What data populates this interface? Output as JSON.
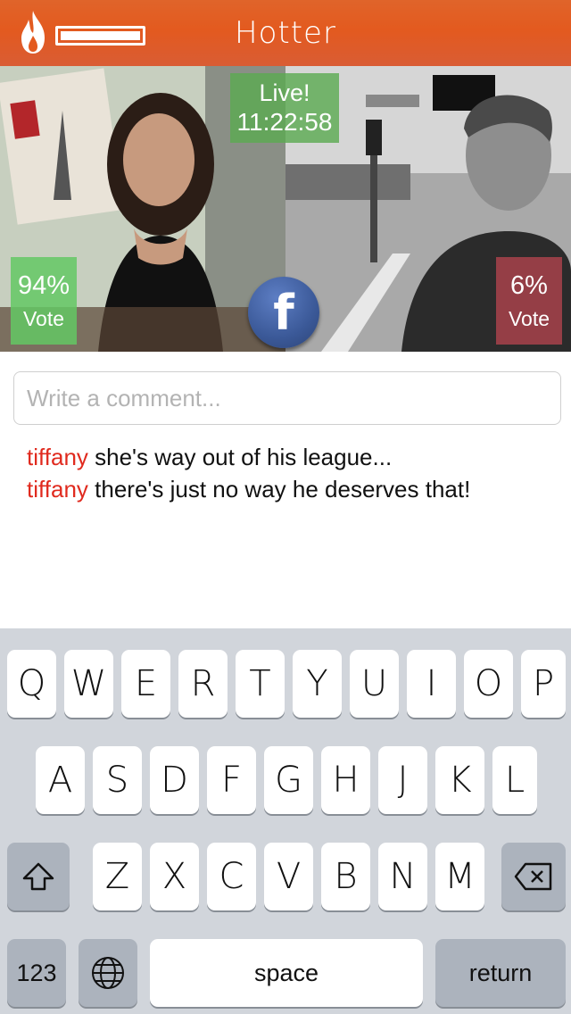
{
  "header": {
    "title": "Hotter",
    "logo_icon": "flame-icon",
    "progress": 1.0,
    "accent_color": "#e35a1f"
  },
  "battle": {
    "live_label": "Live!",
    "countdown": "11:22:58",
    "left": {
      "percent": "94%",
      "vote_label": "Vote",
      "color": "#64c864"
    },
    "right": {
      "percent": "6%",
      "vote_label": "Vote",
      "color": "#b94650"
    },
    "share_icon": "facebook-icon"
  },
  "comments": {
    "placeholder": "Write a comment...",
    "items": [
      {
        "user": "tiffany",
        "text": "she's way out of his league..."
      },
      {
        "user": "tiffany",
        "text": "there's just no way he deserves that!"
      }
    ],
    "username_color": "#e02a1e"
  },
  "keyboard": {
    "row1": [
      "Q",
      "W",
      "E",
      "R",
      "T",
      "Y",
      "U",
      "I",
      "O",
      "P"
    ],
    "row2": [
      "A",
      "S",
      "D",
      "F",
      "G",
      "H",
      "J",
      "K",
      "L"
    ],
    "row3": [
      "Z",
      "X",
      "C",
      "V",
      "B",
      "N",
      "M"
    ],
    "shift_icon": "shift-icon",
    "delete_icon": "backspace-icon",
    "numbers_label": "123",
    "globe_icon": "globe-icon",
    "space_label": "space",
    "return_label": "return"
  }
}
